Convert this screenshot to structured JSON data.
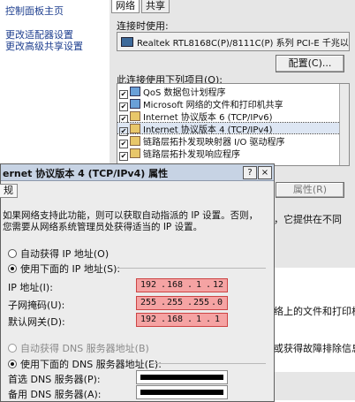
{
  "left_panel": {
    "items": [
      {
        "label": "控制面板主页"
      },
      {
        "label": "更改适配器设置"
      },
      {
        "label": "更改高级共享设置"
      }
    ]
  },
  "bg_dialog": {
    "tabs": [
      "网络",
      "共享"
    ],
    "connect_using_label": "连接时使用:",
    "adapter_name": "Realtek RTL8168C(P)/8111C(P) 系列 PCI-E 千兆以",
    "configure_button": "配置(C)...",
    "items_label": "此连接使用下列项目(O):",
    "items": [
      {
        "label": "QoS 数据包计划程序",
        "checked": true
      },
      {
        "label": "Microsoft 网络的文件和打印机共享",
        "checked": true
      },
      {
        "label": "Internet 协议版本 6 (TCP/IPv6)",
        "checked": true
      },
      {
        "label": "Internet 协议版本 4 (TCP/IPv4)",
        "checked": true,
        "selected": true
      },
      {
        "label": "链路层拓扑发现映射器 I/O 驱动程序",
        "checked": true
      },
      {
        "label": "链路层拓扑发现响应程序",
        "checked": true
      }
    ],
    "properties_button": "属性(R)",
    "desc_fragment_1": "，它提供在不同",
    "desc_fragment_2": "络上的文件和打印机，",
    "desc_fragment_3": "或获得故障排除信息。"
  },
  "fg_dialog": {
    "title": "ernet 协议版本 4 (TCP/IPv4) 属性",
    "help_button": "?",
    "close_button": "×",
    "tab_label": "规",
    "description_line1": "如果网络支持此功能，则可以获取自动指派的 IP 设置。否则，",
    "description_line2": "您需要从网络系统管理员处获得适当的 IP 设置。",
    "radio_auto_ip": "自动获得 IP 地址(O)",
    "radio_static_ip": "使用下面的 IP 地址(S):",
    "ip_label": "IP 地址(I):",
    "ip_value": [
      "192",
      "168",
      "1",
      "12"
    ],
    "mask_label": "子网掩码(U):",
    "mask_value": [
      "255",
      "255",
      "255",
      "0"
    ],
    "gateway_label": "默认网关(D):",
    "gateway_value": [
      "192",
      "168",
      "1",
      "1"
    ],
    "radio_auto_dns": "自动获得 DNS 服务器地址(B)",
    "radio_static_dns": "使用下面的 DNS 服务器地址(E):",
    "dns_primary_label": "首选 DNS 服务器(P):",
    "dns_secondary_label": "备用 DNS 服务器(A):"
  }
}
